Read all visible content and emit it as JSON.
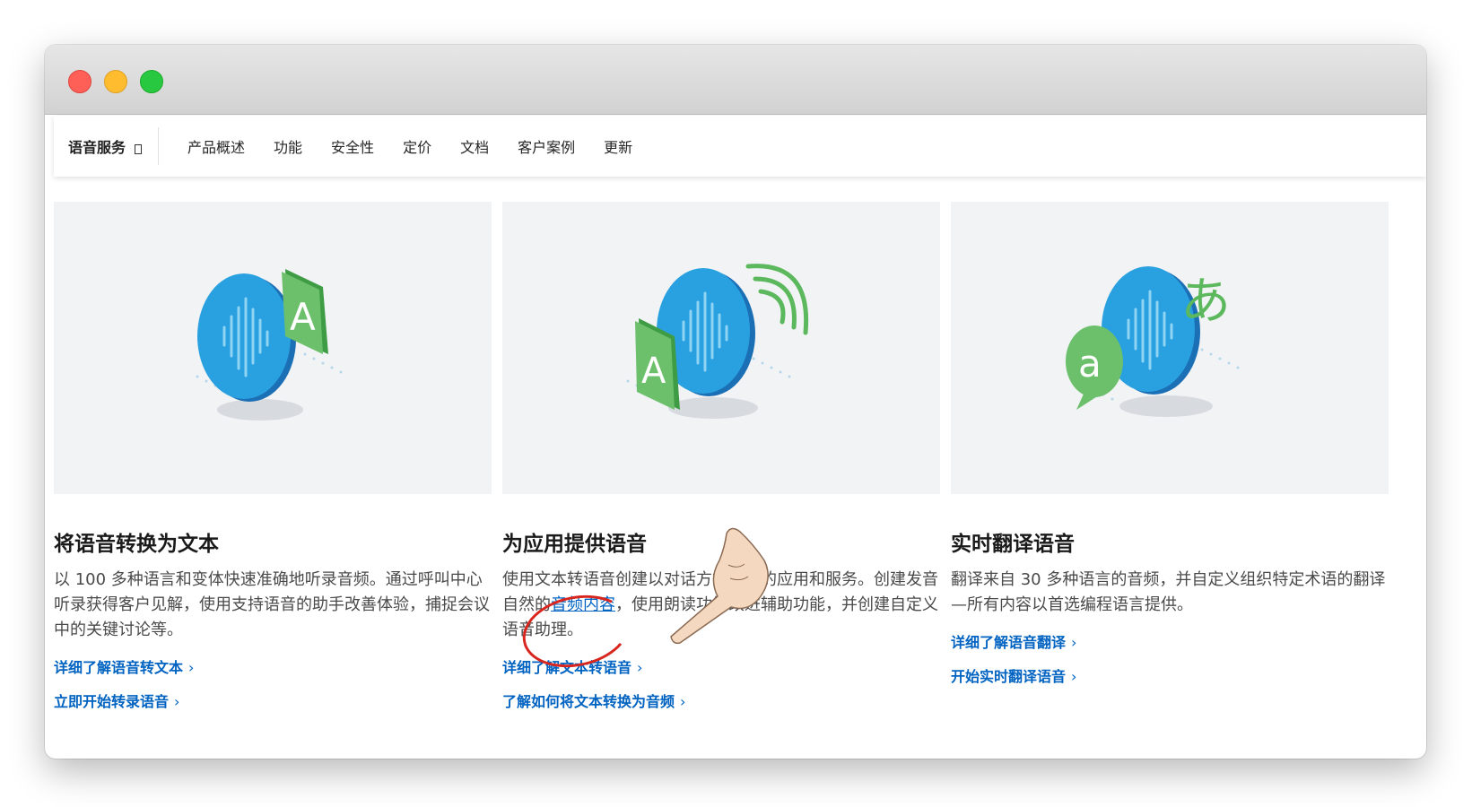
{
  "colors": {
    "accent": "#0063c1",
    "mic_blue": "#1c8fd8",
    "icon_green": "#5cb85c",
    "annotation_red": "#d8261f"
  },
  "nav": {
    "brand": "语音服务",
    "brand_icon": "chevron-down-icon",
    "items": [
      "产品概述",
      "功能",
      "安全性",
      "定价",
      "文档",
      "客户案例",
      "更新"
    ]
  },
  "cards": [
    {
      "title": "将语音转换为文本",
      "description": "以 100 多种语言和变体快速准确地听录音频。通过呼叫中心听录获得客户见解，使用支持语音的助手改善体验，捕捉会议中的关键讨论等。",
      "links": [
        "详细了解语音转文本",
        "立即开始转录语音"
      ]
    },
    {
      "title": "为应用提供语音",
      "desc_part1": "使用文本转语音创建以对话方式朗读的应用和服务。创建发音自然的",
      "desc_link": "音频内容",
      "desc_part2": "，使用朗读功能改进辅助功能，并创建自定义语音助理。",
      "links": [
        "详细了解文本转语音",
        "了解如何将文本转换为音频"
      ]
    },
    {
      "title": "实时翻译语音",
      "description": "翻译来自 30 多种语言的音频，并自定义组织特定术语的翻译—所有内容以首选编程语言提供。",
      "links": [
        "详细了解语音翻译",
        "开始实时翻译语音"
      ]
    }
  ],
  "illustrations": {
    "card1": {
      "letter": "A"
    },
    "card2": {
      "letter": "A"
    },
    "card3": {
      "letter1": "a",
      "letter2": "あ"
    }
  },
  "chevron": "›"
}
